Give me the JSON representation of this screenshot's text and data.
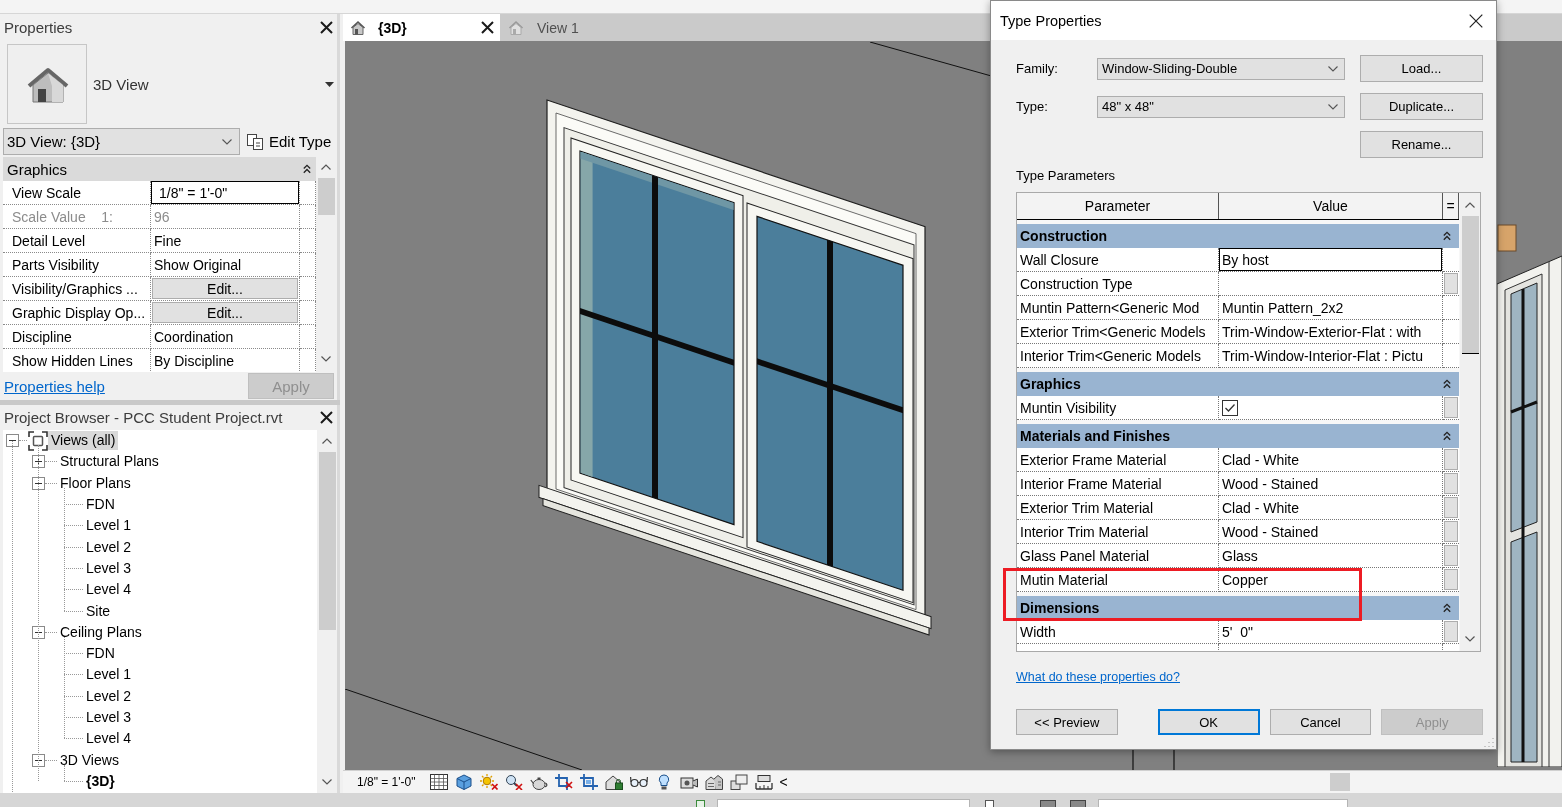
{
  "properties": {
    "title": "Properties",
    "type_name": "3D View",
    "instance": "3D View: {3D}",
    "edit_type": "Edit Type",
    "groups": [
      {
        "label": "Graphics",
        "expanded": true,
        "rows": [
          {
            "name": "View Scale",
            "value": "1/8\" = 1'-0\"",
            "kind": "text",
            "disabled": false,
            "focused": true
          },
          {
            "name": "Scale Value    1:",
            "value": "96",
            "kind": "text",
            "disabled": true,
            "focused": false
          },
          {
            "name": "Detail Level",
            "value": "Fine",
            "kind": "text",
            "disabled": false,
            "focused": false
          },
          {
            "name": "Parts Visibility",
            "value": "Show Original",
            "kind": "text",
            "disabled": false,
            "focused": false
          },
          {
            "name": "Visibility/Graphics ...",
            "value": "Edit...",
            "kind": "button",
            "disabled": false,
            "focused": false
          },
          {
            "name": "Graphic Display Op...",
            "value": "Edit...",
            "kind": "button",
            "disabled": false,
            "focused": false
          },
          {
            "name": "Discipline",
            "value": "Coordination",
            "kind": "text",
            "disabled": false,
            "focused": false
          },
          {
            "name": "Show Hidden Lines",
            "value": "By Discipline",
            "kind": "text",
            "disabled": false,
            "focused": false
          }
        ]
      }
    ],
    "help_link": "Properties help",
    "apply": {
      "label": "Apply",
      "disabled": true
    }
  },
  "project_browser": {
    "title": "Project Browser - PCC Student Project.rvt",
    "tree": [
      {
        "label": "Views (all)",
        "kind": "root",
        "expanded": true,
        "selected": true,
        "children": [
          {
            "label": "Structural Plans",
            "kind": "group",
            "expanded": false,
            "selected": false
          },
          {
            "label": "Floor Plans",
            "kind": "group",
            "expanded": true,
            "selected": false,
            "children": [
              {
                "label": "FDN",
                "kind": "view",
                "selected": false,
                "current": false
              },
              {
                "label": "Level 1",
                "kind": "view",
                "selected": false,
                "current": false
              },
              {
                "label": "Level 2",
                "kind": "view",
                "selected": false,
                "current": false
              },
              {
                "label": "Level 3",
                "kind": "view",
                "selected": false,
                "current": false
              },
              {
                "label": "Level 4",
                "kind": "view",
                "selected": false,
                "current": false
              },
              {
                "label": "Site",
                "kind": "view",
                "selected": false,
                "current": false
              }
            ]
          },
          {
            "label": "Ceiling Plans",
            "kind": "group",
            "expanded": true,
            "selected": false,
            "children": [
              {
                "label": "FDN",
                "kind": "view",
                "selected": false,
                "current": false
              },
              {
                "label": "Level 1",
                "kind": "view",
                "selected": false,
                "current": false
              },
              {
                "label": "Level 2",
                "kind": "view",
                "selected": false,
                "current": false
              },
              {
                "label": "Level 3",
                "kind": "view",
                "selected": false,
                "current": false
              },
              {
                "label": "Level 4",
                "kind": "view",
                "selected": false,
                "current": false
              }
            ]
          },
          {
            "label": "3D Views",
            "kind": "group",
            "expanded": true,
            "selected": false,
            "children": [
              {
                "label": "{3D}",
                "kind": "view",
                "selected": false,
                "current": true
              }
            ]
          }
        ]
      }
    ]
  },
  "view": {
    "tabs": [
      {
        "label": "{3D}",
        "selected": true
      },
      {
        "label": "View 1",
        "selected": false
      }
    ],
    "scale": "1/8\" = 1'-0\"",
    "bar_toggle": "<"
  },
  "type_properties": {
    "title": "Type Properties",
    "fields": [
      {
        "label": "Family:",
        "value": "Window-Sliding-Double"
      },
      {
        "label": "Type:",
        "value": "48\" x 48\""
      }
    ],
    "side_buttons": [
      "Load...",
      "Duplicate...",
      "Rename..."
    ],
    "parameters_label": "Type Parameters",
    "table": {
      "columns": [
        "Parameter",
        "Value",
        "="
      ],
      "groups": [
        {
          "label": "Construction",
          "expanded": true,
          "rows": [
            {
              "parameter": "Wall Closure",
              "value": "By host",
              "kind": "text",
              "focused": true,
              "browse_button": false
            },
            {
              "parameter": "Construction Type",
              "kind": "text",
              "focused": false,
              "browse_button": true
            },
            {
              "parameter": "Muntin Pattern<Generic Mod",
              "value": "Muntin Pattern_2x2",
              "kind": "text",
              "focused": false,
              "browse_button": false
            },
            {
              "parameter": "Exterior Trim<Generic Models",
              "value": "Trim-Window-Exterior-Flat : with",
              "kind": "text",
              "focused": false,
              "browse_button": false
            },
            {
              "parameter": "Interior Trim<Generic Models",
              "value": "Trim-Window-Interior-Flat : Pictu",
              "kind": "text",
              "focused": false,
              "browse_button": false
            }
          ]
        },
        {
          "label": "Graphics",
          "expanded": true,
          "rows": [
            {
              "parameter": "Muntin Visibility",
              "kind": "checkbox",
              "checked": true,
              "focused": false,
              "browse_button": true
            }
          ]
        },
        {
          "label": "Materials and Finishes",
          "expanded": true,
          "rows": [
            {
              "parameter": "Exterior Frame Material",
              "value": "Clad - White",
              "kind": "text",
              "focused": false,
              "browse_button": true
            },
            {
              "parameter": "Interior Frame Material",
              "value": "Wood - Stained",
              "kind": "text",
              "focused": false,
              "browse_button": true
            },
            {
              "parameter": "Exterior Trim Material",
              "value": "Clad - White",
              "kind": "text",
              "focused": false,
              "browse_button": true
            },
            {
              "parameter": "Interior Trim Material",
              "value": "Wood - Stained",
              "kind": "text",
              "focused": false,
              "browse_button": true
            },
            {
              "parameter": "Glass Panel Material",
              "value": "Glass",
              "kind": "text",
              "focused": false,
              "browse_button": true
            },
            {
              "parameter": "Mutin Material",
              "value": "Copper",
              "kind": "text",
              "focused": false,
              "browse_button": true
            }
          ]
        },
        {
          "label": "Dimensions",
          "expanded": true,
          "rows": [
            {
              "parameter": "Width",
              "value": "5'  0\"",
              "kind": "text",
              "focused": false,
              "browse_button": true
            }
          ]
        }
      ]
    },
    "help_link": "What do these properties do?",
    "buttons": [
      {
        "label": "<< Preview",
        "default": false,
        "disabled": false
      },
      {
        "label": "OK",
        "default": true,
        "disabled": false
      },
      {
        "label": "Cancel",
        "default": false,
        "disabled": false
      },
      {
        "label": "Apply",
        "default": false,
        "disabled": true
      }
    ]
  }
}
